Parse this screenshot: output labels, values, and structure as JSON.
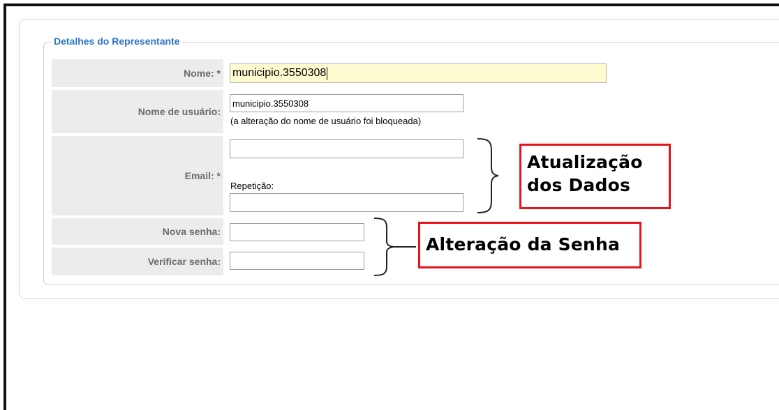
{
  "form": {
    "legend": "Detalhes do Representante",
    "nome": {
      "label": "Nome: *",
      "value": "municipio.3550308"
    },
    "usuario": {
      "label": "Nome de usuário:",
      "value": "municipio.3550308",
      "note": "(a alteração do nome de usuário foi bloqueada)"
    },
    "email": {
      "label": "Email: *",
      "value": "",
      "repeat_label": "Repetição:",
      "repeat_value": ""
    },
    "nova_senha": {
      "label": "Nova senha:",
      "value": ""
    },
    "verificar_senha": {
      "label": "Verificar senha:",
      "value": ""
    }
  },
  "annotations": {
    "dados_line1": "Atualização",
    "dados_line2": "dos Dados",
    "senha": "Alteração da Senha",
    "callout_border_color": "#e8141c"
  }
}
